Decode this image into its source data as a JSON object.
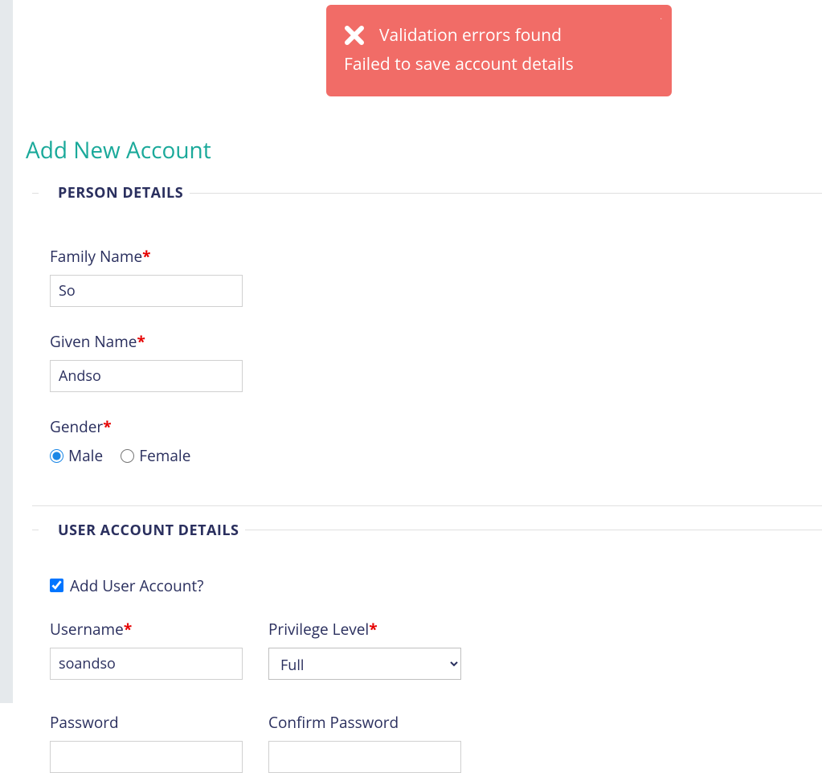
{
  "toast": {
    "title": "Validation errors found",
    "body": "Failed to save account details"
  },
  "page": {
    "title": "Add New Account"
  },
  "person": {
    "legend": "PERSON DETAILS",
    "family_name_label": "Family Name",
    "family_name_value": "So",
    "given_name_label": "Given Name",
    "given_name_value": "Andso",
    "gender_label": "Gender",
    "gender_options": {
      "male": "Male",
      "female": "Female"
    },
    "gender_selected": "male"
  },
  "account": {
    "legend": "USER ACCOUNT DETAILS",
    "add_user_label": "Add User Account?",
    "add_user_checked": true,
    "username_label": "Username",
    "username_value": "soandso",
    "privilege_label": "Privilege Level",
    "privilege_value": "Full",
    "password_label": "Password",
    "password_value": "",
    "confirm_password_label": "Confirm Password",
    "confirm_password_value": ""
  }
}
